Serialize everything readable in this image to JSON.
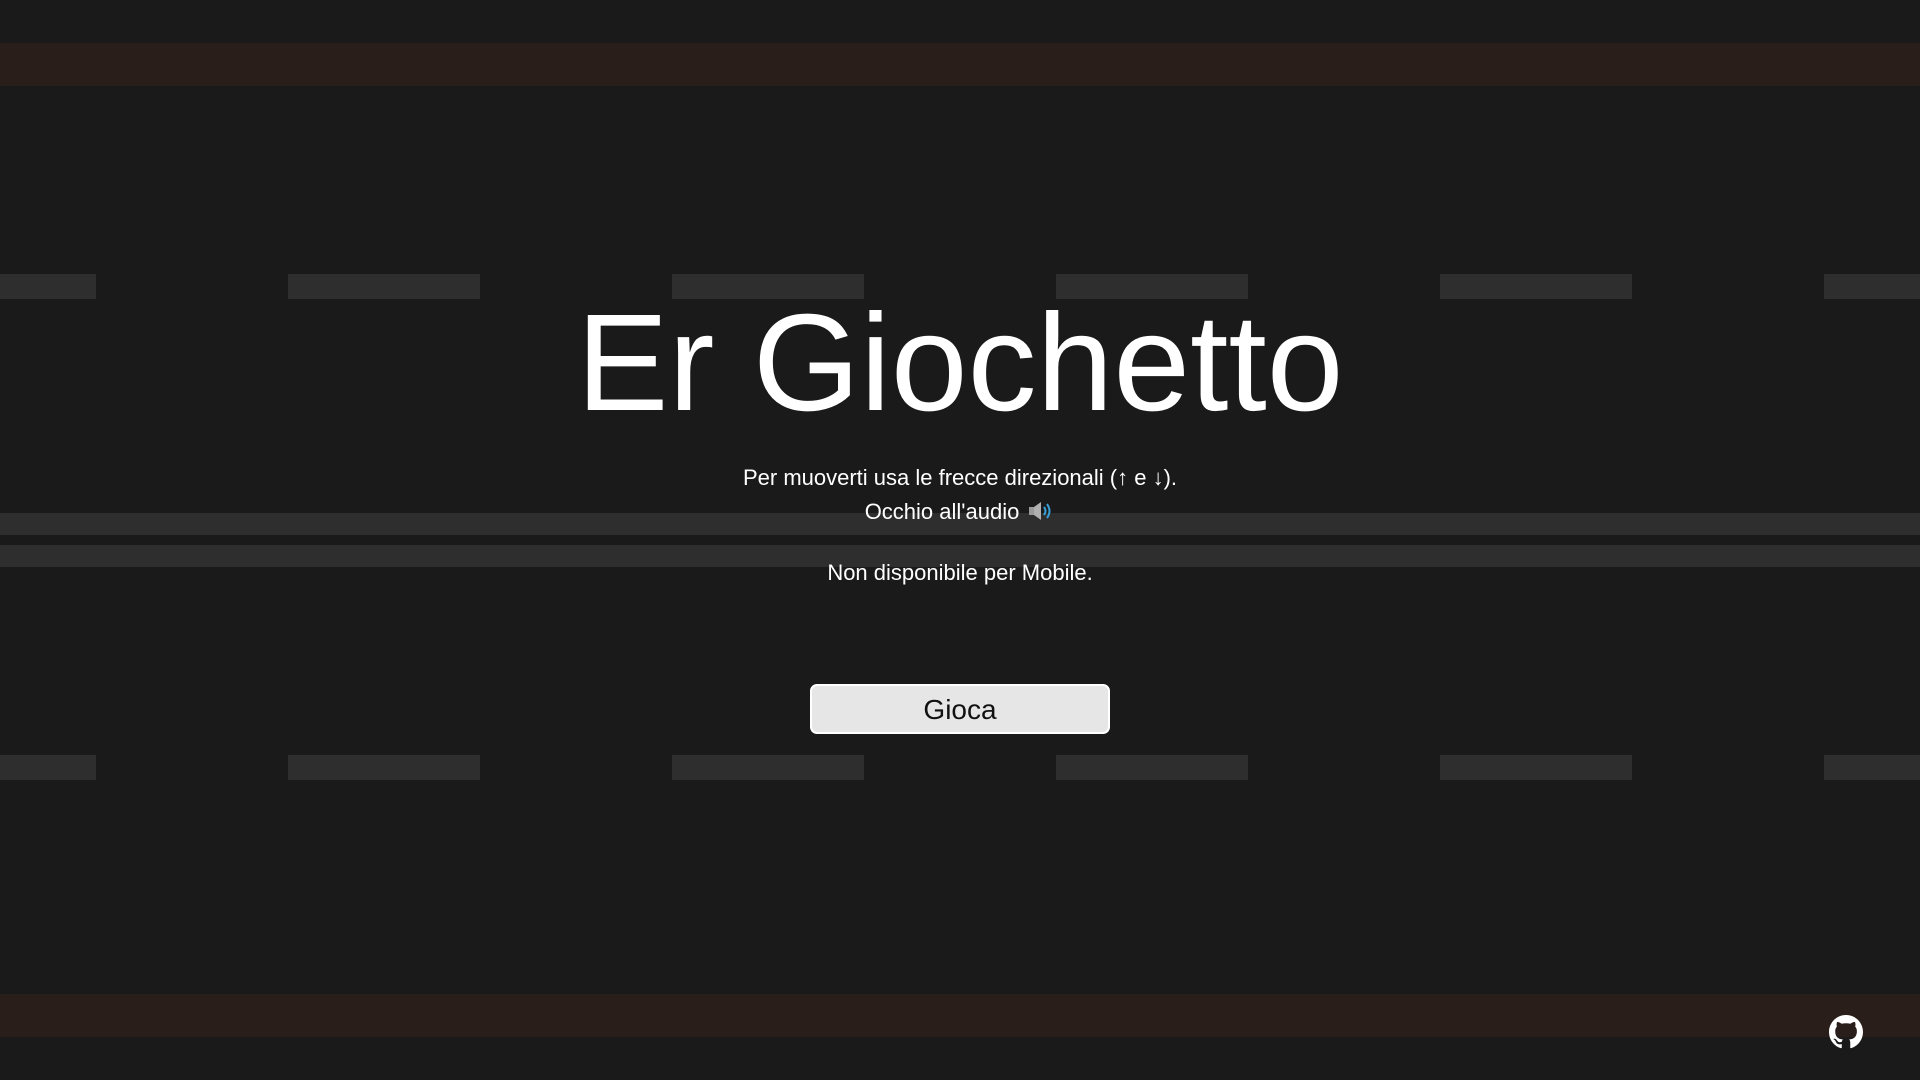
{
  "game": {
    "title": "Er Giochetto",
    "instructions": {
      "line1": "Per muoverti usa le frecce direzionali (↑ e ↓).",
      "line2": "Occhio all'audio"
    },
    "mobile_note": "Non disponibile per Mobile.",
    "play_label": "Gioca"
  },
  "icons": {
    "audio": "speaker-icon",
    "github": "github-icon"
  },
  "colors": {
    "background": "#1a1a1a",
    "band": "#2a1e1a",
    "lane_marking": "#2e2e2e",
    "text": "#ffffff",
    "button_bg": "#e6e6e6",
    "speaker_waves": "#3aa0d8"
  }
}
